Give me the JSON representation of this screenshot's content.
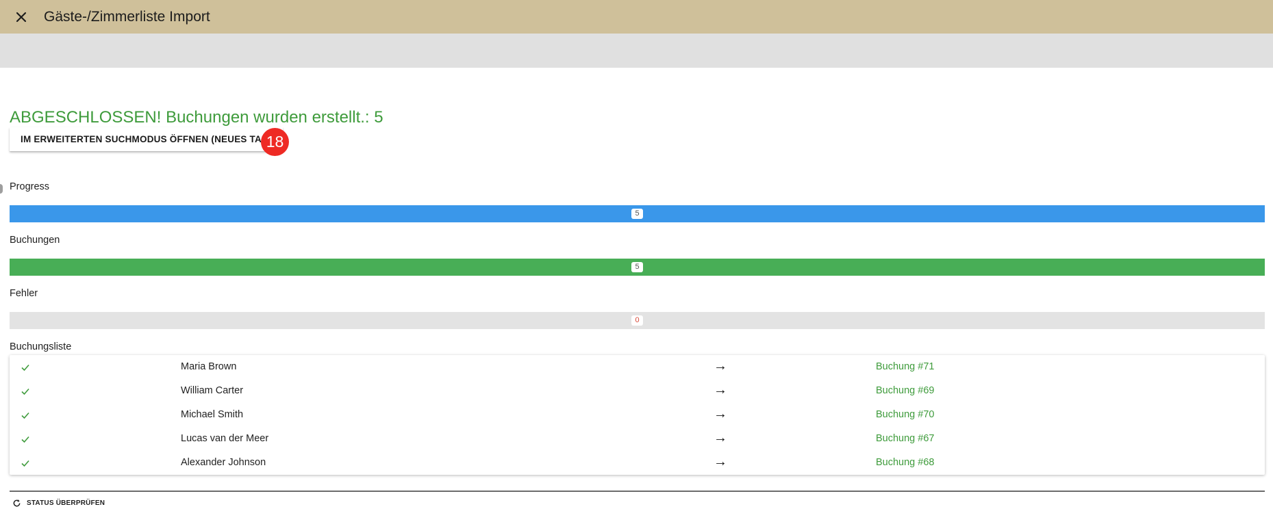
{
  "header": {
    "title": "Gäste-/Zimmerliste Import",
    "close_icon": "close-icon",
    "background_color": "#cfc09a"
  },
  "status": {
    "heading": "ABGESCHLOSSEN! Buchungen wurden erstellt.: 5",
    "color": "#3e9b3b"
  },
  "open_search_button": {
    "label": "IM ERWEITERTEN SUCHMODUS ÖFFNEN (NEUES TAB)"
  },
  "badge": {
    "value": "18"
  },
  "progress": {
    "label": "Progress",
    "count": "5",
    "fill": 1.0,
    "color": "#3a97ea"
  },
  "bookings": {
    "label": "Buchungen",
    "count": "5",
    "fill": 1.0,
    "color": "#48ae56"
  },
  "errors": {
    "label": "Fehler",
    "count": "0",
    "fill": 0.0,
    "color": "#e3e3e3"
  },
  "booking_list": {
    "label": "Buchungsliste",
    "arrow": "→",
    "check_icon": "check-icon",
    "rows": [
      {
        "name": "Maria Brown",
        "link": "Buchung #71"
      },
      {
        "name": "William Carter",
        "link": "Buchung #69"
      },
      {
        "name": "Michael Smith",
        "link": "Buchung #70"
      },
      {
        "name": "Lucas van der Meer",
        "link": "Buchung #67"
      },
      {
        "name": "Alexander Johnson",
        "link": "Buchung #68"
      }
    ]
  },
  "status_check_button": {
    "label": "STATUS ÜBERPRÜFEN",
    "icon": "refresh-icon"
  }
}
